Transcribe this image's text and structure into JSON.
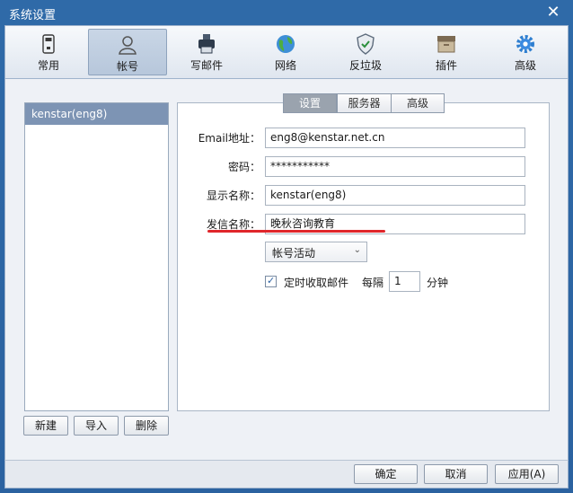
{
  "window": {
    "title": "系统设置",
    "close_glyph": "✕"
  },
  "toolbar": {
    "items": [
      {
        "label": "常用",
        "icon": "phone-icon",
        "active": false
      },
      {
        "label": "帐号",
        "icon": "user-icon",
        "active": true
      },
      {
        "label": "写邮件",
        "icon": "printer-icon",
        "active": false
      },
      {
        "label": "网络",
        "icon": "globe-icon",
        "active": false
      },
      {
        "label": "反垃圾",
        "icon": "shield-icon",
        "active": false
      },
      {
        "label": "插件",
        "icon": "box-icon",
        "active": false
      },
      {
        "label": "高级",
        "icon": "gear-icon",
        "active": false
      }
    ]
  },
  "accounts": {
    "items": [
      "kenstar(eng8)"
    ]
  },
  "account_buttons": {
    "new": "新建",
    "import": "导入",
    "delete": "删除"
  },
  "tabs": [
    "设置",
    "服务器",
    "高级"
  ],
  "form": {
    "email_label": "Email地址：",
    "email_value": "eng8@kenstar.net.cn",
    "password_label": "密码：",
    "password_value": "***********",
    "display_name_label": "显示名称：",
    "display_name_value": "kenstar(eng8)",
    "sender_name_label": "发信名称：",
    "sender_name_value": "晚秋咨询教育",
    "status_select": "帐号活动",
    "auto_fetch_label": "定时收取邮件",
    "auto_fetch_checked": true,
    "interval_label": "每隔",
    "interval_value": "1",
    "interval_unit": "分钟"
  },
  "footer": {
    "ok": "确定",
    "cancel": "取消",
    "apply": "应用(A)"
  },
  "colors": {
    "accent": "#2b62a0",
    "highlight": "#e0262b",
    "selected": "#7d94b4"
  }
}
